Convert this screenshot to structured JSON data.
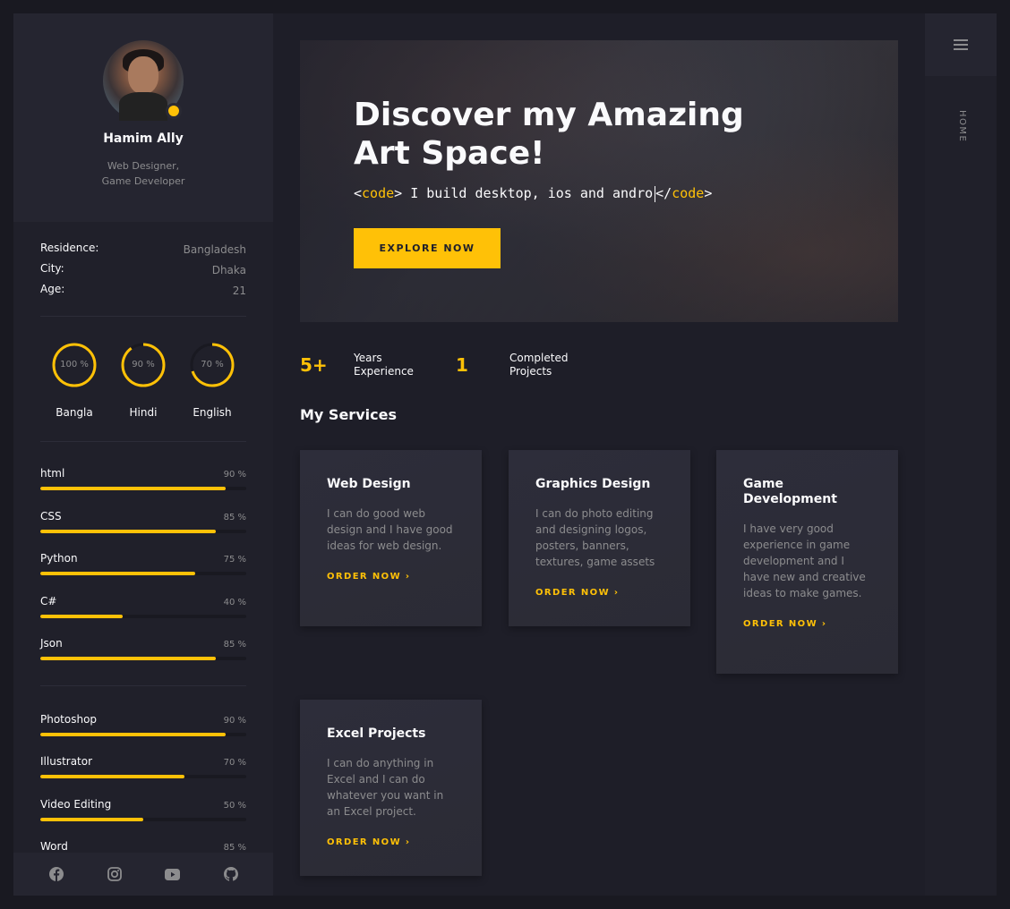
{
  "profile": {
    "name": "Hamim Ally",
    "role_line1": "Web Designer,",
    "role_line2": "Game Developer",
    "status_color": "#ffc107"
  },
  "info": [
    {
      "key": "Residence:",
      "value": "Bangladesh"
    },
    {
      "key": "City:",
      "value": "Dhaka"
    },
    {
      "key": "Age:",
      "value": "21"
    }
  ],
  "languages": [
    {
      "label": "Bangla",
      "percent_text": "100 %",
      "percent": 100
    },
    {
      "label": "Hindi",
      "percent_text": "90 %",
      "percent": 90
    },
    {
      "label": "English",
      "percent_text": "70 %",
      "percent": 70
    }
  ],
  "skills": [
    {
      "label": "html",
      "percent_text": "90 %",
      "percent": 90
    },
    {
      "label": "CSS",
      "percent_text": "85 %",
      "percent": 85
    },
    {
      "label": "Python",
      "percent_text": "75 %",
      "percent": 75
    },
    {
      "label": "C#",
      "percent_text": "40 %",
      "percent": 40
    },
    {
      "label": "Json",
      "percent_text": "85 %",
      "percent": 85
    }
  ],
  "tools": [
    {
      "label": "Photoshop",
      "percent_text": "90 %",
      "percent": 90
    },
    {
      "label": "Illustrator",
      "percent_text": "70 %",
      "percent": 70
    },
    {
      "label": "Video Editing",
      "percent_text": "50 %",
      "percent": 50
    },
    {
      "label": "Word",
      "percent_text": "85 %",
      "percent": 85
    }
  ],
  "social_icons": [
    "facebook-icon",
    "instagram-icon",
    "youtube-icon",
    "github-icon"
  ],
  "banner": {
    "title_line1": "Discover my Amazing",
    "title_line2": "Art Space!",
    "code_open": "code",
    "code_text": " I build desktop, ios and andro",
    "code_close": "code",
    "button_label": "EXPLORE NOW"
  },
  "stats": [
    {
      "number": "5+",
      "label_line1": "Years",
      "label_line2": "Experience"
    },
    {
      "number": "1",
      "label_line1": "Completed",
      "label_line2": "Projects"
    }
  ],
  "services_title": "My Services",
  "services": [
    {
      "title": "Web Design",
      "text": "I can do good web design and I have good ideas for web design.",
      "cta": "ORDER NOW"
    },
    {
      "title": "Graphics Design",
      "text": "I can do photo editing and designing logos, posters, banners, textures, game assets",
      "cta": "ORDER NOW"
    },
    {
      "title": "Game Development",
      "text": "I have very good experience in game development and I have new and creative ideas to make games.",
      "cta": "ORDER NOW"
    },
    {
      "title": "Excel Projects",
      "text": "I can do anything in Excel and I can do whatever you want in an Excel project.",
      "cta": "ORDER NOW"
    }
  ],
  "nav": {
    "home_label": "HOME"
  },
  "colors": {
    "accent": "#ffc107",
    "background": "#1e1e28",
    "panel": "#20202a",
    "muted_text": "#8c8c8e"
  }
}
